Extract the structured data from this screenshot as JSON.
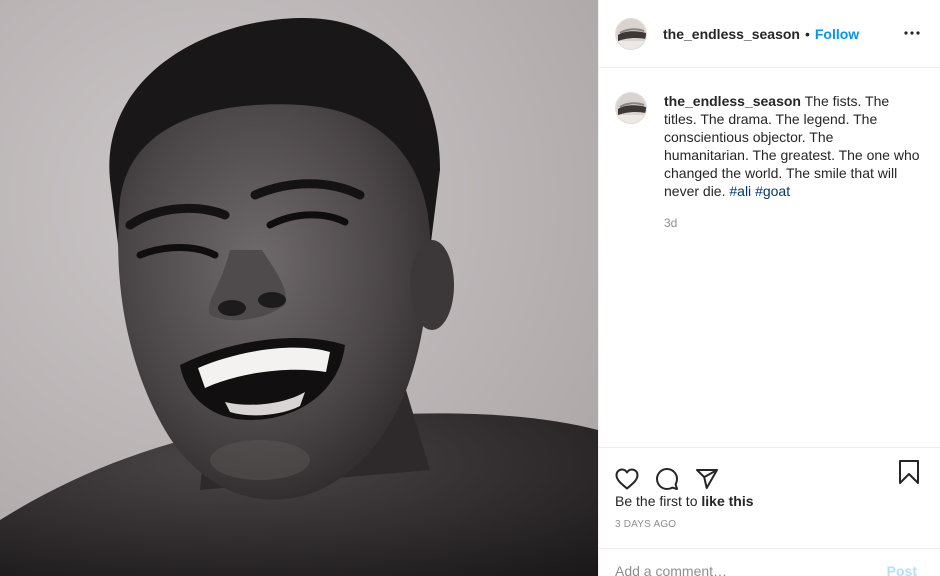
{
  "post": {
    "author": "the_endless_season",
    "separator": "•",
    "follow_label": "Follow",
    "caption_text": "The fists. The titles. The drama. The legend. The conscientious objector. The humanitarian. The greatest. The one who changed the world. The smile that will never die.",
    "hashtags": [
      "#ali",
      "#goat"
    ],
    "caption_time": "3d",
    "likes_prefix": "Be the first to",
    "likes_action": "like this",
    "posted_ago": "3 DAYS AGO",
    "comment_placeholder": "Add a comment…",
    "post_button": "Post"
  },
  "icons": {
    "more": "more-options-icon",
    "like": "heart-icon",
    "comment": "comment-bubble-icon",
    "share": "paper-plane-icon",
    "save": "bookmark-icon"
  },
  "colors": {
    "link_blue": "#0095f6",
    "hashtag": "#00376b",
    "muted": "#8e8e8e",
    "post_disabled": "#b2dffc"
  }
}
